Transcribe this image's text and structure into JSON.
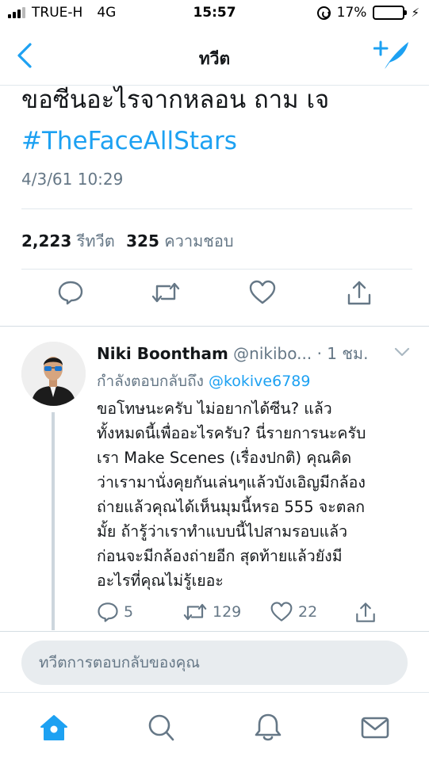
{
  "status_bar": {
    "carrier": "TRUE-H",
    "network": "4G",
    "time": "15:57",
    "battery": "17%",
    "battery_level": 0.17
  },
  "nav": {
    "title": "ทวีต",
    "back_icon": "chevron-left-icon",
    "compose_icon": "compose-tweet-icon"
  },
  "tweet": {
    "text": "ขอซีนอะไรจากหลอน ถาม เจ",
    "hashtag": "#TheFaceAllStars",
    "date": "4/3/61 10:29",
    "retweets_count": "2,223",
    "retweets_label": "รีทวีต",
    "likes_count": "325",
    "likes_label": "ความชอบ"
  },
  "reply": {
    "name": "Niki Boontham",
    "handle": "@nikibo...",
    "time": "· 1 ชม.",
    "replying_prefix": "กำลังตอบกลับถึง",
    "replying_to": "@kokive6789",
    "lines": [
      "ขอโทษนะครับ ไม่อยากได้ซีน? แล้ว",
      "ทั้งหมดนี้เพื่ออะไรครับ? นี่รายการนะครับ",
      "เรา Make Scenes (เรื่องปกติ)  คุณคิด",
      "ว่าเรามานั่งคุยกันเล่นๆแล้วบังเอิญมีกล้อง",
      "ถ่ายแล้วคุณได้เห็นมุมนี้หรอ 555 จะตลก",
      "มั้ย ถ้ารู้ว่าเราทำแบบนี้ไปสามรอบแล้ว",
      "ก่อนจะมีกล้องถ่ายอีก สุดท้ายแล้วยังมี",
      "อะไรที่คุณไม่รู้เยอะ"
    ],
    "reply_count": "5",
    "retweet_count": "129",
    "like_count": "22"
  },
  "composer": {
    "placeholder": "ทวีตการตอบกลับของคุณ"
  },
  "tab_bar": {
    "items": [
      "home-icon",
      "search-icon",
      "notifications-icon",
      "messages-icon"
    ],
    "active": "home-icon"
  },
  "colors": {
    "accent": "#1da1f2",
    "text": "#14171a",
    "muted": "#657786",
    "battery": "#f4c400"
  }
}
